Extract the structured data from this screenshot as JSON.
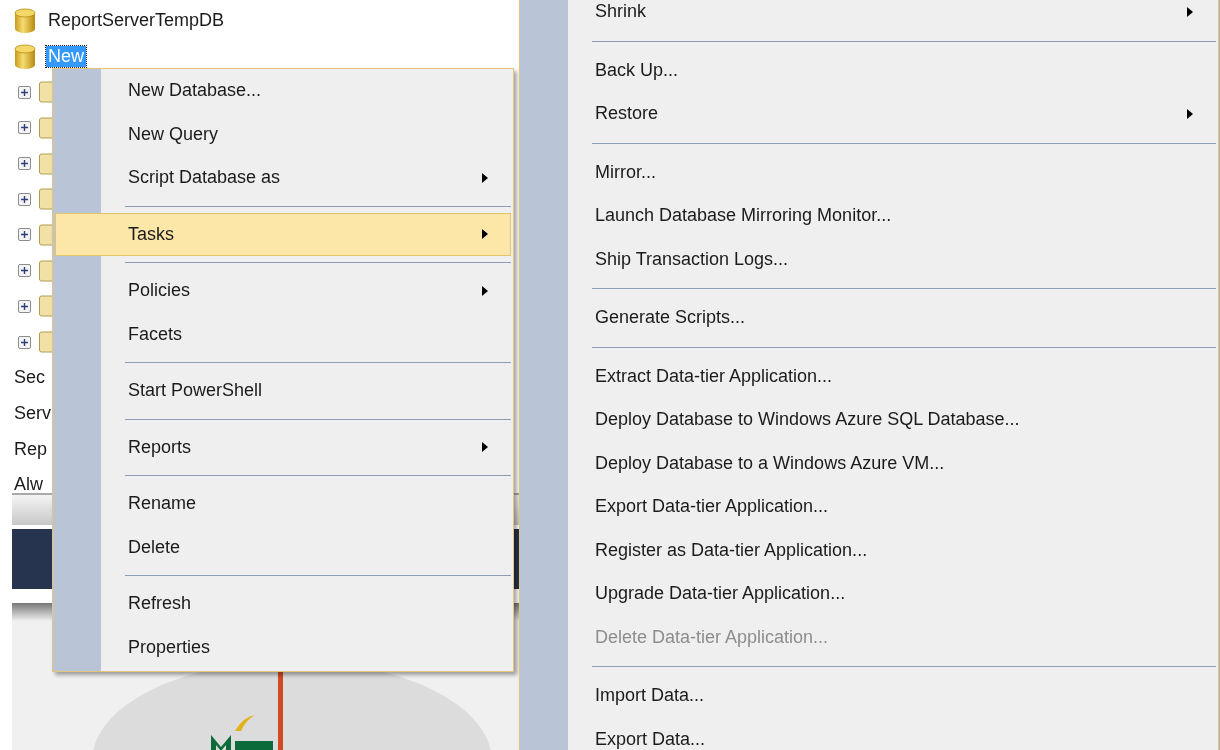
{
  "tree": [
    {
      "kind": "database",
      "label": "ReportServerTempDB",
      "selected": false
    },
    {
      "kind": "database",
      "label": "New",
      "selected": true
    },
    {
      "kind": "folder",
      "expanded": false
    },
    {
      "kind": "folder",
      "expanded": false
    },
    {
      "kind": "folder",
      "expanded": false
    },
    {
      "kind": "folder",
      "expanded": false
    },
    {
      "kind": "folder",
      "expanded": false
    },
    {
      "kind": "folder",
      "expanded": false
    },
    {
      "kind": "folder",
      "expanded": false
    },
    {
      "kind": "folder",
      "expanded": false
    },
    {
      "kind": "node",
      "label": "Sec"
    },
    {
      "kind": "node",
      "label": "Serv"
    },
    {
      "kind": "node",
      "label": "Rep"
    },
    {
      "kind": "node",
      "label": "Alw"
    }
  ],
  "context_menu": [
    {
      "kind": "item",
      "label": "New Database...",
      "submenu": false,
      "selected": false
    },
    {
      "kind": "item",
      "label": "New Query",
      "submenu": false,
      "selected": false
    },
    {
      "kind": "item",
      "label": "Script Database as",
      "submenu": true,
      "selected": false
    },
    {
      "kind": "separator"
    },
    {
      "kind": "item",
      "label": "Tasks",
      "submenu": true,
      "selected": true
    },
    {
      "kind": "separator"
    },
    {
      "kind": "item",
      "label": "Policies",
      "submenu": true,
      "selected": false
    },
    {
      "kind": "item",
      "label": "Facets",
      "submenu": false,
      "selected": false
    },
    {
      "kind": "separator"
    },
    {
      "kind": "item",
      "label": "Start PowerShell",
      "submenu": false,
      "selected": false
    },
    {
      "kind": "separator"
    },
    {
      "kind": "item",
      "label": "Reports",
      "submenu": true,
      "selected": false
    },
    {
      "kind": "separator"
    },
    {
      "kind": "item",
      "label": "Rename",
      "submenu": false,
      "selected": false
    },
    {
      "kind": "item",
      "label": "Delete",
      "submenu": false,
      "selected": false
    },
    {
      "kind": "separator"
    },
    {
      "kind": "item",
      "label": "Refresh",
      "submenu": false,
      "selected": false
    },
    {
      "kind": "item",
      "label": "Properties",
      "submenu": false,
      "selected": false
    }
  ],
  "tasks_submenu": [
    {
      "kind": "item",
      "label": "Shrink",
      "submenu": true,
      "disabled": false
    },
    {
      "kind": "separator"
    },
    {
      "kind": "item",
      "label": "Back Up...",
      "submenu": false,
      "disabled": false
    },
    {
      "kind": "item",
      "label": "Restore",
      "submenu": true,
      "disabled": false
    },
    {
      "kind": "separator"
    },
    {
      "kind": "item",
      "label": "Mirror...",
      "submenu": false,
      "disabled": false
    },
    {
      "kind": "item",
      "label": "Launch Database Mirroring Monitor...",
      "submenu": false,
      "disabled": false
    },
    {
      "kind": "item",
      "label": "Ship Transaction Logs...",
      "submenu": false,
      "disabled": false
    },
    {
      "kind": "separator"
    },
    {
      "kind": "item",
      "label": "Generate Scripts...",
      "submenu": false,
      "disabled": false
    },
    {
      "kind": "separator"
    },
    {
      "kind": "item",
      "label": "Extract Data-tier Application...",
      "submenu": false,
      "disabled": false
    },
    {
      "kind": "item",
      "label": "Deploy Database to Windows Azure SQL Database...",
      "submenu": false,
      "disabled": false
    },
    {
      "kind": "item",
      "label": "Deploy Database to a Windows Azure VM...",
      "submenu": false,
      "disabled": false
    },
    {
      "kind": "item",
      "label": "Export Data-tier Application...",
      "submenu": false,
      "disabled": false
    },
    {
      "kind": "item",
      "label": "Register as Data-tier Application...",
      "submenu": false,
      "disabled": false
    },
    {
      "kind": "item",
      "label": "Upgrade Data-tier Application...",
      "submenu": false,
      "disabled": false
    },
    {
      "kind": "item",
      "label": "Delete Data-tier Application...",
      "submenu": false,
      "disabled": true
    },
    {
      "kind": "separator"
    },
    {
      "kind": "item",
      "label": "Import Data...",
      "submenu": false,
      "disabled": false
    },
    {
      "kind": "item",
      "label": "Export Data...",
      "submenu": false,
      "disabled": false
    }
  ]
}
